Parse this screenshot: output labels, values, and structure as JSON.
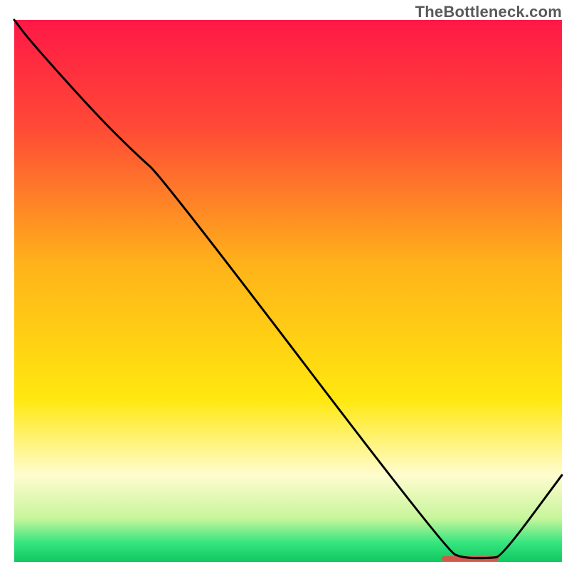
{
  "attribution": "TheBottleneck.com",
  "chart_data": {
    "type": "line",
    "title": "",
    "xlabel": "",
    "ylabel": "",
    "xlim": [
      0,
      100
    ],
    "ylim": [
      0,
      100
    ],
    "grid": false,
    "legend": false,
    "annotations": [],
    "background": {
      "description": "vertical gradient from red (top) through orange, yellow, light-yellow to green (bottom)",
      "stops": [
        {
          "offset": 0.0,
          "color": "#ff1846"
        },
        {
          "offset": 0.2,
          "color": "#ff4a36"
        },
        {
          "offset": 0.45,
          "color": "#ffb21a"
        },
        {
          "offset": 0.7,
          "color": "#ffe80f"
        },
        {
          "offset": 0.84,
          "color": "#fffccf"
        },
        {
          "offset": 0.92,
          "color": "#c7f59b"
        },
        {
          "offset": 0.965,
          "color": "#35e57e"
        },
        {
          "offset": 1.0,
          "color": "#10c760"
        }
      ]
    },
    "series": [
      {
        "name": "bottleneck-curve",
        "stroke": "#000000",
        "stroke_width": 3,
        "x": [
          0.0,
          3.0,
          15.0,
          22.5,
          27.0,
          79.0,
          82.0,
          87.0,
          89.0,
          100.0
        ],
        "values": [
          100.0,
          96.0,
          82.5,
          75.0,
          71.0,
          2.0,
          0.7,
          0.7,
          1.0,
          16.0
        ]
      }
    ],
    "optimum_marker": {
      "description": "short horizontal reddish segment on baseline marking optimum region",
      "color": "#d05a4a",
      "x_start": 78.5,
      "x_end": 88.0,
      "y": 0.6,
      "thickness": 7
    }
  }
}
